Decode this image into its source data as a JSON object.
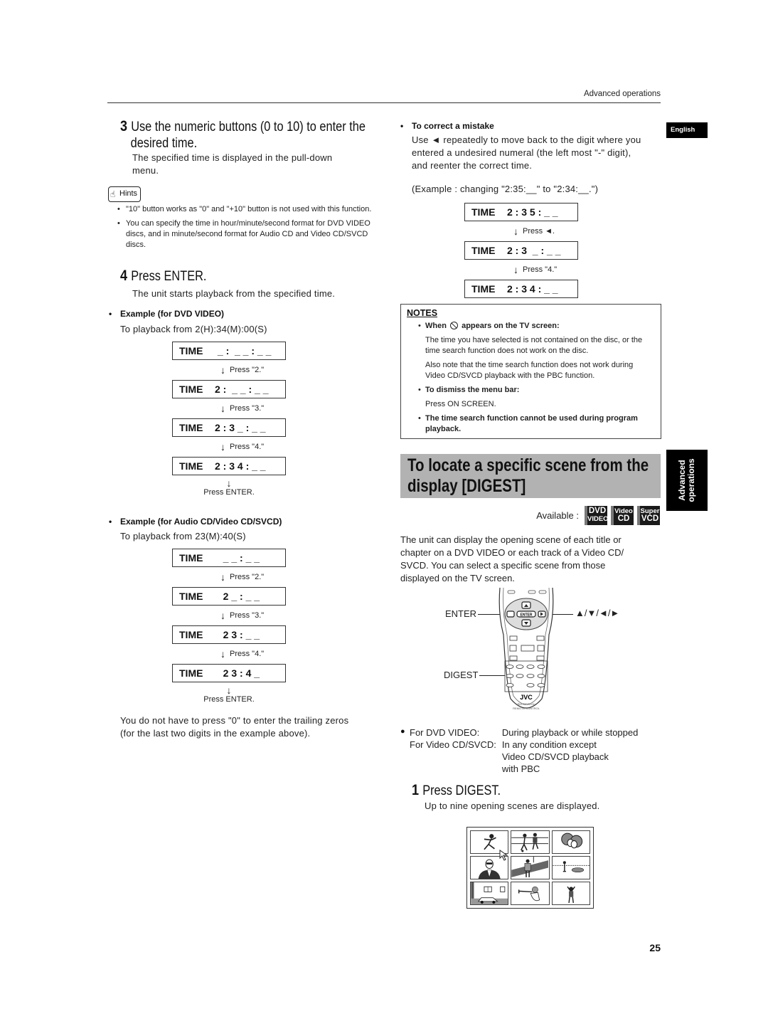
{
  "header": {
    "running_head": "Advanced operations"
  },
  "side_tabs": {
    "language": "English",
    "section_line1": "Advanced",
    "section_line2": "operations"
  },
  "left_column": {
    "step3": {
      "number": "3",
      "title_line1": "Use the numeric buttons (0 to 10) to enter the",
      "title_line2": "desired time.",
      "desc_line1": "The specified time is displayed in the pull-down",
      "desc_line2": "menu."
    },
    "hints": {
      "badge": "Hints",
      "items": [
        "\"10\" button works as \"0\" and \"+10\" button is not used with this function.",
        "You can specify the time in hour/minute/second format for DVD VIDEO discs, and in minute/second format for Audio CD and Video CD/SVCD discs."
      ]
    },
    "step4": {
      "number": "4",
      "title": "Press ENTER.",
      "desc": "The unit starts playback from the specified time."
    },
    "example_dvd": {
      "heading": "Example (for DVD VIDEO)",
      "subtitle": "To playback from 2(H):34(M):00(S)",
      "boxes": [
        {
          "label": "TIME",
          "value": " _ :  _ _ : _ _"
        },
        {
          "label": "TIME",
          "value": "2 :  _ _ : _ _"
        },
        {
          "label": "TIME",
          "value": "2 : 3 _ : _ _"
        },
        {
          "label": "TIME",
          "value": "2 : 3 4 : _ _"
        }
      ],
      "steps": [
        "Press \"2.\"",
        "Press \"3.\"",
        "Press \"4.\""
      ],
      "final": "Press ENTER."
    },
    "example_cd": {
      "heading": "Example (for Audio CD/Video CD/SVCD)",
      "subtitle": "To playback from 23(M):40(S)",
      "boxes": [
        {
          "label": "TIME",
          "value": "   _ _ : _ _"
        },
        {
          "label": "TIME",
          "value": "   2 _ : _ _"
        },
        {
          "label": "TIME",
          "value": "   2 3 : _ _"
        },
        {
          "label": "TIME",
          "value": "   2 3 : 4 _"
        }
      ],
      "steps": [
        "Press \"2.\"",
        "Press \"3.\"",
        "Press \"4.\""
      ],
      "final": "Press ENTER."
    },
    "trailing_note_line1": "You do not have to press \"0\" to enter the trailing zeros",
    "trailing_note_line2": "(for the last two digits in the example above)."
  },
  "right_column": {
    "correct_mistake": {
      "heading": "To correct a mistake",
      "body_line1": "Use ◄ repeatedly to move back to the digit where you",
      "body_line2": "entered a undesired numeral (the left most \"-\" digit),",
      "body_line3": "and reenter the correct time.",
      "example": "(Example : changing \"2:35:__\" to \"2:34:__.\")",
      "boxes": [
        {
          "label": "TIME",
          "value": "2 : 3 5 : _ _"
        },
        {
          "label": "TIME",
          "value": "2 : 3  _ : _ _"
        },
        {
          "label": "TIME",
          "value": "2 : 3 4 : _ _"
        }
      ],
      "steps": [
        "Press ◄.",
        "Press \"4.\""
      ]
    },
    "notes": {
      "title": "NOTES",
      "n1_head_pre": "When",
      "n1_head_post": "appears on the TV screen:",
      "n1_p1": "The time you have selected is not contained on the disc, or the time search function does not work on the disc.",
      "n1_p2": "Also note that the time search function does not work during Video CD/SVCD playback with the PBC function.",
      "n2_head": "To dismiss the menu bar:",
      "n2_body": "Press ON SCREEN.",
      "n3_head": "The time search function cannot be used during program playback."
    },
    "digest_section": {
      "title_line1": "To locate a specific scene from the",
      "title_line2": "display [DIGEST]",
      "available_label": "Available :",
      "discs": [
        {
          "top": "DVD",
          "bottom": "VIDEO"
        },
        {
          "top": "Video",
          "bottom": "CD"
        },
        {
          "top": "Super",
          "bottom": "VCD"
        }
      ],
      "intro_line1": "The unit can display the opening scene of each title or",
      "intro_line2": "chapter on a DVD VIDEO or each track of a Video CD/",
      "intro_line3": "SVCD. You can select a specific scene from those",
      "intro_line4": "displayed on the TV screen.",
      "remote": {
        "enter_label": "ENTER",
        "digest_label": "DIGEST",
        "arrows_label": "▲/▼/◄/►",
        "brand": "JVC",
        "model": "RM-SXV010U",
        "caption": "REMOTE CONTROL",
        "center_button": "ENTER"
      },
      "conditions": [
        {
          "key": "For DVD VIDEO:",
          "value": "During playback or while stopped"
        },
        {
          "key": "For Video CD/SVCD:",
          "value": "In any condition except"
        },
        {
          "key": "",
          "value": "Video CD/SVCD playback"
        },
        {
          "key": "",
          "value": "with PBC"
        }
      ],
      "step1": {
        "number": "1",
        "title": "Press DIGEST.",
        "desc": "Up to nine opening scenes are displayed."
      },
      "thumbnails": [
        "baseball-player",
        "soccer-players",
        "couple-kissing",
        "man-in-sunglasses",
        "man-on-street",
        "beach-scene",
        "building-with-car",
        "trumpet-player",
        "person-waving"
      ]
    }
  },
  "footer": {
    "page_number": "25"
  }
}
